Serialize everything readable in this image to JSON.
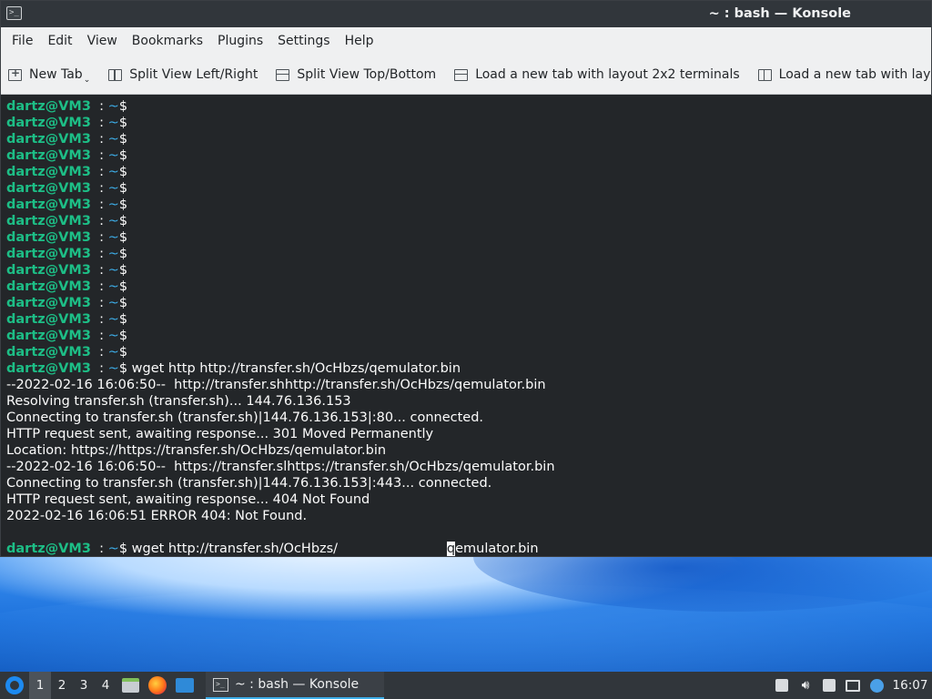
{
  "window": {
    "title": "~ : bash — Konsole",
    "app_icon_glyph": ">_"
  },
  "menubar": {
    "items": [
      "File",
      "Edit",
      "View",
      "Bookmarks",
      "Plugins",
      "Settings",
      "Help"
    ]
  },
  "toolbar": {
    "new_tab": "New Tab",
    "split_lr": "Split View Left/Right",
    "split_tb": "Split View Top/Bottom",
    "layout_2x2": "Load a new tab with layout 2x2 terminals",
    "layout_other": "Load a new tab with layou"
  },
  "terminal": {
    "user": "dartz@VM3",
    "sep": "  : ",
    "path": "~",
    "prompt_symbol": "$",
    "lines": [
      {
        "kind": "prompt",
        "cmd": ""
      },
      {
        "kind": "prompt",
        "cmd": ""
      },
      {
        "kind": "prompt",
        "cmd": ""
      },
      {
        "kind": "prompt",
        "cmd": ""
      },
      {
        "kind": "prompt",
        "cmd": ""
      },
      {
        "kind": "prompt",
        "cmd": ""
      },
      {
        "kind": "prompt",
        "cmd": ""
      },
      {
        "kind": "prompt",
        "cmd": ""
      },
      {
        "kind": "prompt",
        "cmd": ""
      },
      {
        "kind": "prompt",
        "cmd": ""
      },
      {
        "kind": "prompt",
        "cmd": ""
      },
      {
        "kind": "prompt",
        "cmd": ""
      },
      {
        "kind": "prompt",
        "cmd": ""
      },
      {
        "kind": "prompt",
        "cmd": ""
      },
      {
        "kind": "prompt",
        "cmd": ""
      },
      {
        "kind": "prompt",
        "cmd": ""
      },
      {
        "kind": "prompt",
        "cmd": " wget http http://transfer.sh/OcHbzs/qemulator.bin"
      },
      {
        "kind": "text",
        "text": "--2022-02-16 16:06:50--  http://transfer.shhttp://transfer.sh/OcHbzs/qemulator.bin"
      },
      {
        "kind": "text",
        "text": "Resolving transfer.sh (transfer.sh)... 144.76.136.153"
      },
      {
        "kind": "text",
        "text": "Connecting to transfer.sh (transfer.sh)|144.76.136.153|:80... connected."
      },
      {
        "kind": "text",
        "text": "HTTP request sent, awaiting response... 301 Moved Permanently"
      },
      {
        "kind": "text",
        "text": "Location: https://https://transfer.sh/OcHbzs/qemulator.bin"
      },
      {
        "kind": "text",
        "text": "--2022-02-16 16:06:50--  https://transfer.slhttps://transfer.sh/OcHbzs/qemulator.bin"
      },
      {
        "kind": "text",
        "text": "Connecting to transfer.sh (transfer.sh)|144.76.136.153|:443... connected."
      },
      {
        "kind": "text",
        "text": "HTTP request sent, awaiting response... 404 Not Found"
      },
      {
        "kind": "text",
        "text": "2022-02-16 16:06:51 ERROR 404: Not Found."
      },
      {
        "kind": "text",
        "text": ""
      }
    ],
    "current_cmd_before": " wget http://transfer.sh/OcHbzs/                          ",
    "cursor_char": "q",
    "current_cmd_after": "emulator.bin"
  },
  "taskbar": {
    "desktops": [
      "1",
      "2",
      "3",
      "4"
    ],
    "active_desktop": "1",
    "task_label": "~ : bash — Konsole",
    "clock": "16:07"
  },
  "colors": {
    "prompt_user": "#1dbe86",
    "prompt_path": "#3daee9",
    "terminal_bg": "#232629",
    "terminal_fg": "#fcfcfc"
  }
}
